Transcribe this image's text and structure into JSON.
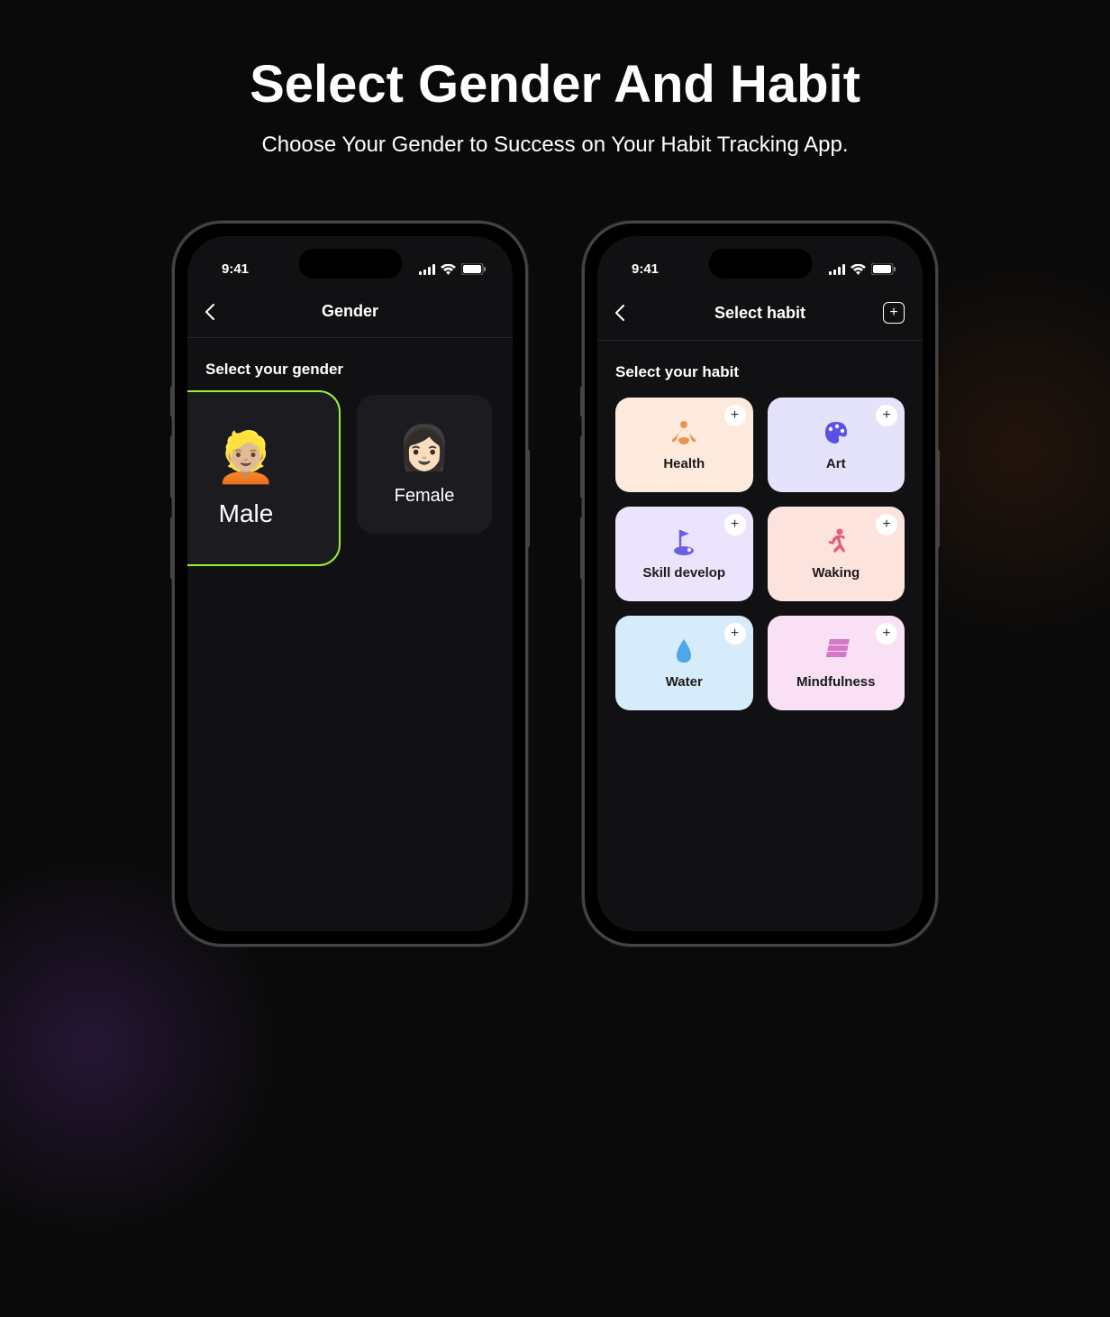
{
  "page": {
    "title": "Select Gender And Habit",
    "subtitle": "Choose Your Gender to Success on Your Habit Tracking App."
  },
  "statusBar": {
    "time": "9:41"
  },
  "genderScreen": {
    "navTitle": "Gender",
    "sectionLabel": "Select your gender",
    "options": [
      {
        "emoji": "👱🏼",
        "label": "Male"
      },
      {
        "emoji": "👩🏻",
        "label": "Female"
      }
    ]
  },
  "habitScreen": {
    "navTitle": "Select habit",
    "sectionLabel": "Select your habit",
    "habits": [
      {
        "label": "Health"
      },
      {
        "label": "Art"
      },
      {
        "label": "Skill develop"
      },
      {
        "label": "Waking"
      },
      {
        "label": "Water"
      },
      {
        "label": "Mindfulness"
      }
    ]
  }
}
